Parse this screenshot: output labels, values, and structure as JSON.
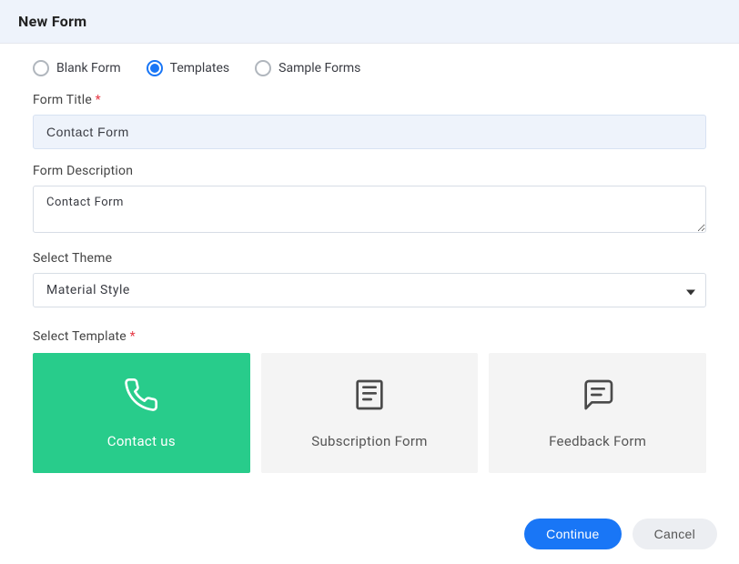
{
  "header": {
    "title": "New Form"
  },
  "formTypeOptions": {
    "blank": "Blank Form",
    "templates": "Templates",
    "sample": "Sample Forms",
    "selected": "templates"
  },
  "fields": {
    "title": {
      "label": "Form Title",
      "value": "Contact Form"
    },
    "description": {
      "label": "Form Description",
      "value": "Contact Form"
    },
    "theme": {
      "label": "Select Theme",
      "value": "Material Style"
    },
    "template": {
      "label": "Select Template"
    }
  },
  "templates": {
    "contact": "Contact us",
    "subscription": "Subscription Form",
    "feedback": "Feedback Form",
    "selected": "contact"
  },
  "buttons": {
    "continue": "Continue",
    "cancel": "Cancel"
  }
}
